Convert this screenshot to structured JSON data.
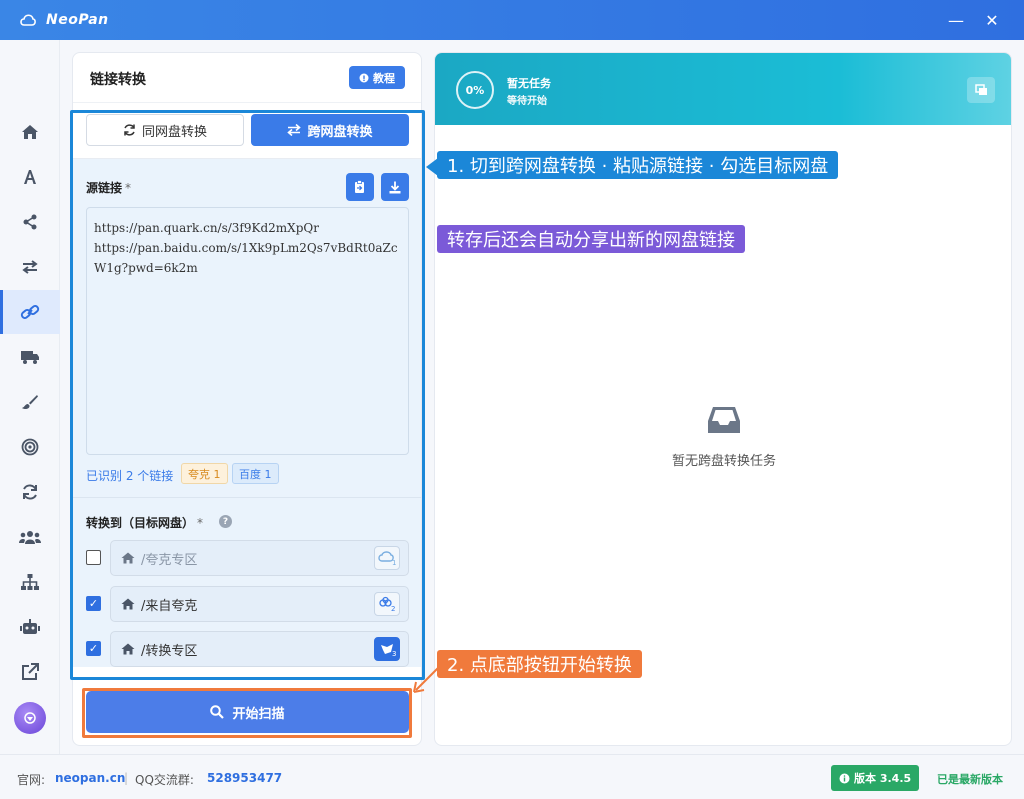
{
  "app": {
    "name": "NeoPan",
    "min_glyph": "—",
    "close_glyph": "✕"
  },
  "sidebar": {
    "items": [
      {
        "name": "home"
      },
      {
        "name": "font"
      },
      {
        "name": "share"
      },
      {
        "name": "transfer"
      },
      {
        "name": "link",
        "active": true
      },
      {
        "name": "truck"
      },
      {
        "name": "brush"
      },
      {
        "name": "target"
      },
      {
        "name": "refresh"
      },
      {
        "name": "users"
      },
      {
        "name": "sitemap"
      },
      {
        "name": "robot"
      },
      {
        "name": "external-link"
      }
    ]
  },
  "left_panel": {
    "title": "链接转换",
    "tutorial_label": "教程",
    "tabs": {
      "same_drive": "同网盘转换",
      "cross_drive": "跨网盘转换"
    },
    "source": {
      "label": "源链接",
      "required_mark": "*",
      "links_text": "https://pan.quark.cn/s/3f9Kd2mXpQr\nhttps://pan.baidu.com/s/1Xk9pLm2Qs7vBdRt0aZcW1g?pwd=6k2m",
      "recognized": "已识别 2 个链接",
      "chips": {
        "quark": "夸克 1",
        "baidu": "百度 1"
      }
    },
    "target": {
      "label": "转换到（目标网盘）",
      "required_mark": "*",
      "help": "?",
      "folders": [
        {
          "path": "/夸克专区",
          "checked": false,
          "dim": true
        },
        {
          "path": "/来自夸克",
          "checked": true,
          "dim": false
        },
        {
          "path": "/转换专区",
          "checked": true,
          "dim": false
        }
      ],
      "checkmark": "✓"
    },
    "start_label": "开始扫描"
  },
  "right_panel": {
    "progress": "0%",
    "status": "暂无任务",
    "substatus": "等待开始",
    "empty_text": "暂无跨盘转换任务"
  },
  "callouts": {
    "step1": "1. 切到跨网盘转换 · 粘贴源链接 · 勾选目标网盘",
    "note": "转存后还会自动分享出新的网盘链接",
    "step2": "2. 点底部按钮开始转换"
  },
  "statusbar": {
    "site_label": "官网:",
    "site_link": "neopan.cn",
    "sep": "|",
    "qq_label": "QQ交流群:",
    "qq_number": "528953477",
    "version": "版本 3.4.5",
    "latest": "已是最新版本"
  },
  "colors": {
    "accent": "#2f6fe0",
    "header_teal": "#1bb4cf",
    "highlight_blue": "#1b87d8",
    "highlight_orange": "#f07a3c",
    "callout_purple": "#7b5ad8",
    "version_green": "#2aa866"
  }
}
